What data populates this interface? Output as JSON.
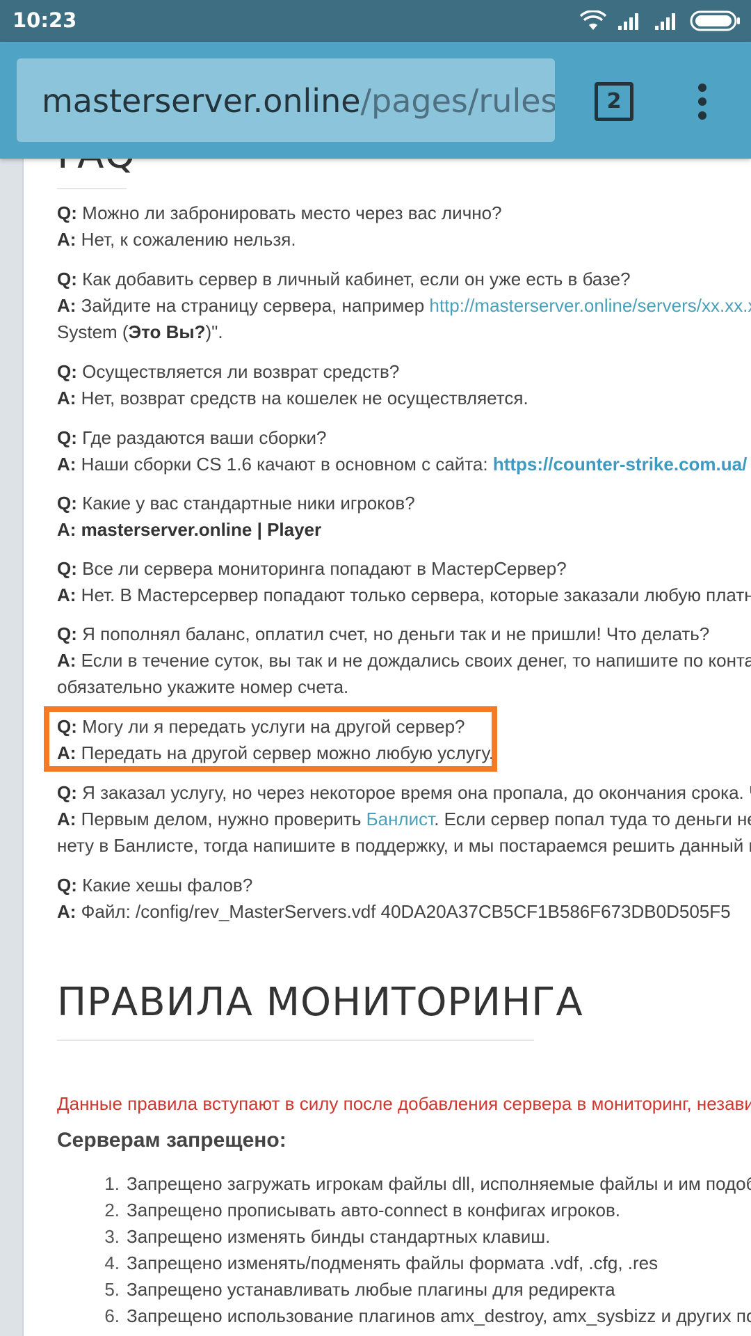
{
  "status_bar": {
    "time": "10:23"
  },
  "browser": {
    "url_host": "masterserver.online",
    "url_path": "/pages/rules.h",
    "tab_count": "2"
  },
  "page": {
    "faq_heading": "FAQ",
    "faq": [
      {
        "q_label": "Q:",
        "q": " Можно ли забронировать место через вас лично?",
        "a_label": "A:",
        "a": " Нет, к сожалению нельзя."
      },
      {
        "q_label": "Q:",
        "q": " Как добавить сервер в личный кабинет, если он уже есть в базе?",
        "a_label": "A:",
        "a_pre": " Зайдите на страницу сервера, например ",
        "a_link": "http://masterserver.online/servers/xx.xx.xx.xx",
        "a_line2_pre": "System (",
        "a_line2_bold": "Это Вы?",
        "a_line2_post": ")\"."
      },
      {
        "q_label": "Q:",
        "q": " Осуществляется ли возврат средств?",
        "a_label": "A:",
        "a": " Нет, возврат средств на кошелек не осуществляется."
      },
      {
        "q_label": "Q:",
        "q": " Где раздаются ваши сборки?",
        "a_label": "A:",
        "a_pre": " Наши сборки CS 1.6 качают в основном с сайта: ",
        "a_link": "https://counter-strike.com.ua/"
      },
      {
        "q_label": "Q:",
        "q": " Какие у вас стандартные ники игроков?",
        "a_label": "A:",
        "a_bold": " masterserver.online | Player"
      },
      {
        "q_label": "Q:",
        "q": " Все ли сервера мониторинга попадают в МастерСервер?",
        "a_label": "A:",
        "a": " Нет. В Мастерсервер попадают только сервера, которые заказали любую платную"
      },
      {
        "q_label": "Q:",
        "q": " Я пополнял баланс, оплатил счет, но деньги так и не пришли! Что делать?",
        "a_label": "A:",
        "a": " Если в течение суток, вы так и не дождались своих денег, то напишите по контакт",
        "a_line2": "обязательно укажите номер счета."
      },
      {
        "q_label": "Q:",
        "q": " Могу ли я передать услуги на другой сервер?",
        "a_label": "A:",
        "a": " Передать на другой сервер можно любую услугу."
      },
      {
        "q_label": "Q:",
        "q": " Я заказал услугу, но через некоторое время она пропала, до окончания срока. Что",
        "a_label": "A:",
        "a_pre": " Первым делом, нужно проверить ",
        "a_link": "Банлист",
        "a_post": ". Если сервер попал туда то деньги не в",
        "a_line2": "нету в Банлисте, тогда напишите в поддержку, и мы постараемся решить данный во"
      },
      {
        "q_label": "Q:",
        "q": " Какие хешы фалов?",
        "a_label": "A:",
        "a": " Файл: /config/rev_MasterServers.vdf 40DA20A37CB5CF1B586F673DB0D505F5"
      }
    ],
    "rules_heading": "ПРАВИЛА МОНИТОРИНГА",
    "rules_note": "Данные правила вступают в силу после добавления сервера в мониторинг, независ",
    "rules_subheading": "Серверам запрещено:",
    "rules": [
      {
        "num": "1.",
        "text": "Запрещено загружать игрокам файлы dll, исполняемые файлы и им подоб"
      },
      {
        "num": "2.",
        "text": "Запрещено прописывать авто-connect в конфигах игроков."
      },
      {
        "num": "3.",
        "text": "Запрещено изменять бинды стандартных клавиш."
      },
      {
        "num": "4.",
        "text": "Запрещено изменять/подменять файлы формата .vdf, .cfg, .res"
      },
      {
        "num": "5.",
        "text": "Запрещено устанавливать любые плагины для редиректа"
      },
      {
        "num": "6.",
        "text": "Запрещено использование плагинов amx_destroy, amx_sysbizz и других по"
      }
    ]
  }
}
